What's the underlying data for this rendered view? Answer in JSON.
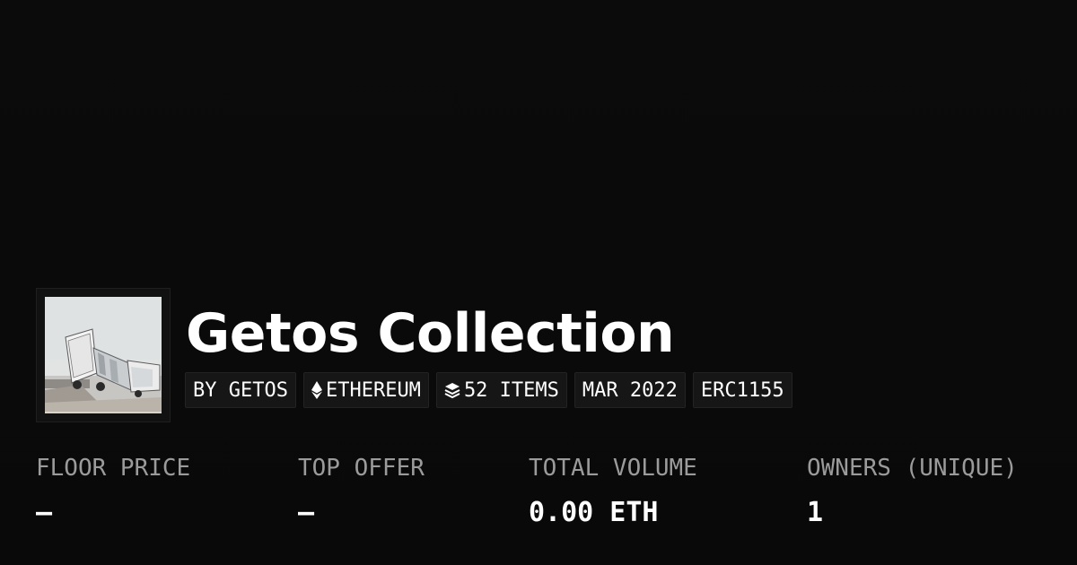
{
  "collection": {
    "name": "Getos Collection",
    "image_alt": "Collection image: white box truck tipped over in snow",
    "badges": [
      {
        "text": "BY GETOS",
        "icon": ""
      },
      {
        "text": "ETHEREUM",
        "icon": "ethereum-icon"
      },
      {
        "text": "52 ITEMS",
        "icon": "layers-icon"
      },
      {
        "text": "MAR 2022",
        "icon": ""
      },
      {
        "text": "ERC1155",
        "icon": ""
      }
    ]
  },
  "stats": [
    {
      "label": "FLOOR PRICE",
      "value": "—"
    },
    {
      "label": "TOP OFFER",
      "value": "—"
    },
    {
      "label": "TOTAL VOLUME",
      "value": "0.00 ETH"
    },
    {
      "label": "OWNERS (UNIQUE)",
      "value": "1"
    }
  ],
  "colors": {
    "background": "#0a0a0a",
    "text": "#ffffff",
    "label": "#9b9b9b",
    "badge_bg": "#161616"
  }
}
